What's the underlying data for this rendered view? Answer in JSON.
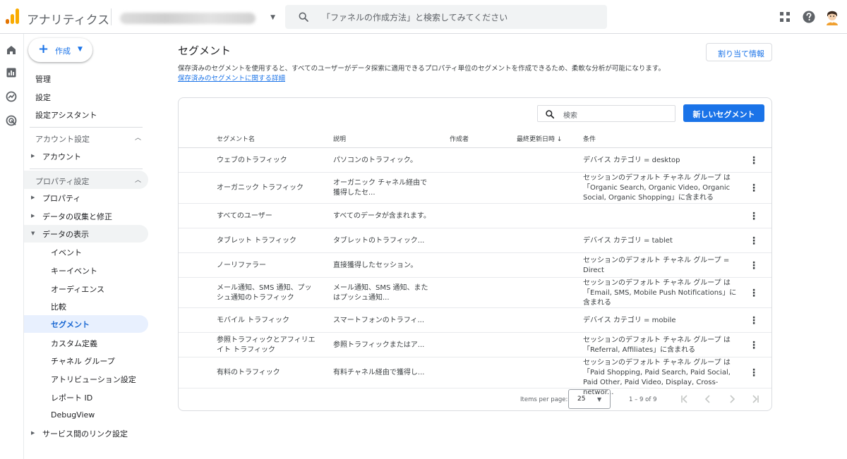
{
  "topbar": {
    "app_title": "アナリティクス",
    "search_placeholder": "「ファネルの作成方法」と検索してみてください"
  },
  "colors": {
    "accent": "#1a73e8",
    "logo_orange": "#f9ab00",
    "logo_dark_orange": "#e37400"
  },
  "nav": {
    "create_label": "作成",
    "top_items": [
      "管理",
      "設定",
      "設定アシスタント"
    ],
    "account_section": {
      "title": "アカウント設定",
      "items": [
        "アカウント"
      ]
    },
    "property_section": {
      "title": "プロパティ設定",
      "items": [
        "プロパティ",
        "データの収集と修正",
        "データの表示"
      ],
      "data_display_children": [
        "イベント",
        "キーイベント",
        "オーディエンス",
        "比較",
        "セグメント",
        "カスタム定義",
        "チャネル グループ",
        "アトリビューション設定",
        "レポート ID",
        "DebugView"
      ],
      "link_settings": "サービス間のリンク設定"
    }
  },
  "main": {
    "title": "セグメント",
    "assign_button": "割り当て情報",
    "description": "保存済みのセグメントを使用すると、すべてのユーザーがデータ探索に適用できるプロパティ単位のセグメントを作成できるため、柔軟な分析が可能になります。",
    "learn_more": "保存済みのセグメントに関する詳細",
    "table_search_placeholder": "検索",
    "new_segment_button": "新しいセグメント",
    "columns": {
      "name": "セグメント名",
      "description": "説明",
      "creator": "作成者",
      "updated": "最終更新日時",
      "condition": "条件"
    },
    "rows": [
      {
        "name": [
          "ウェブのトラフィック"
        ],
        "desc": [
          "パソコンのトラフィック。"
        ],
        "cond": [
          "デバイス カテゴリ = desktop"
        ]
      },
      {
        "name": [
          "オーガニック トラフィック"
        ],
        "desc": [
          "オーガニック チャネル経由で",
          "獲得したセ..."
        ],
        "cond": [
          "セッションのデフォルト チャネル グループ は",
          "「Organic Search, Organic Video, Organic",
          "Social, Organic Shopping」に含まれる"
        ]
      },
      {
        "name": [
          "すべてのユーザー"
        ],
        "desc": [
          "すべてのデータが含まれます。"
        ],
        "cond": []
      },
      {
        "name": [
          "タブレット トラフィック"
        ],
        "desc": [
          "タブレットのトラフィック..."
        ],
        "cond": [
          "デバイス カテゴリ = tablet"
        ]
      },
      {
        "name": [
          "ノーリファラー"
        ],
        "desc": [
          "直接獲得したセッション。"
        ],
        "cond": [
          "セッションのデフォルト チャネル グループ =",
          "Direct"
        ]
      },
      {
        "name": [
          "メール通知、SMS 通知、プッ",
          "シュ通知のトラフィック"
        ],
        "desc": [
          "メール通知、SMS 通知、また",
          "はプッシュ通知..."
        ],
        "cond": [
          "セッションのデフォルト チャネル グループ は",
          "「Email, SMS, Mobile Push Notifications」に",
          "含まれる"
        ]
      },
      {
        "name": [
          "モバイル トラフィック"
        ],
        "desc": [
          "スマートフォンのトラフィ..."
        ],
        "cond": [
          "デバイス カテゴリ = mobile"
        ]
      },
      {
        "name": [
          "参照トラフィックとアフィリエ",
          "イト トラフィック"
        ],
        "desc": [
          "参照トラフィックまたはア..."
        ],
        "cond": [
          "セッションのデフォルト チャネル グループ は",
          "「Referral, Affiliates」に含まれる"
        ]
      },
      {
        "name": [
          "有料のトラフィック"
        ],
        "desc": [
          "有料チャネル経由で獲得し..."
        ],
        "cond": [
          "セッションのデフォルト チャネル グループ は",
          "「Paid Shopping, Paid Search, Paid Social,",
          "Paid Other, Paid Video, Display, Cross-networ..."
        ]
      }
    ],
    "pagination": {
      "items_per_page_label": "Items per page:",
      "items_per_page": "25",
      "range": "1 – 9 of 9"
    }
  }
}
